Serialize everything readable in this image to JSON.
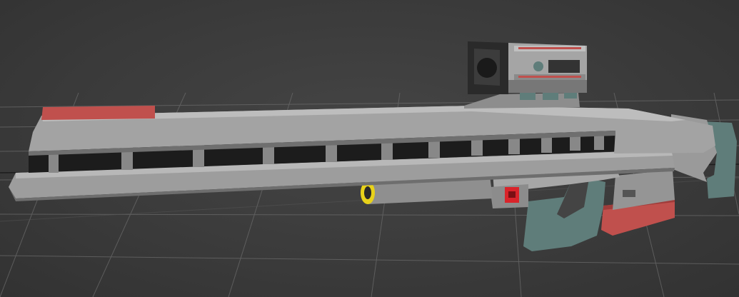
{
  "viewport": {
    "label": "",
    "background": "#3c3c3c",
    "grid_color": "#6e6e6e"
  },
  "model": {
    "palette": {
      "body": "#9a9a9a",
      "body_light": "#b4b4b4",
      "body_dark": "#6f6f6f",
      "accent_red": "#c0504d",
      "grip_teal": "#5f7d7a",
      "trigger_red": "#d9232a",
      "lens_yellow": "#e8d21a",
      "dark": "#1e1e1e"
    },
    "parts": [
      "barrel-upper",
      "barrel-lower",
      "rail-slots",
      "scope",
      "foregrip-tube",
      "pistol-grip",
      "magazine",
      "stock"
    ]
  }
}
